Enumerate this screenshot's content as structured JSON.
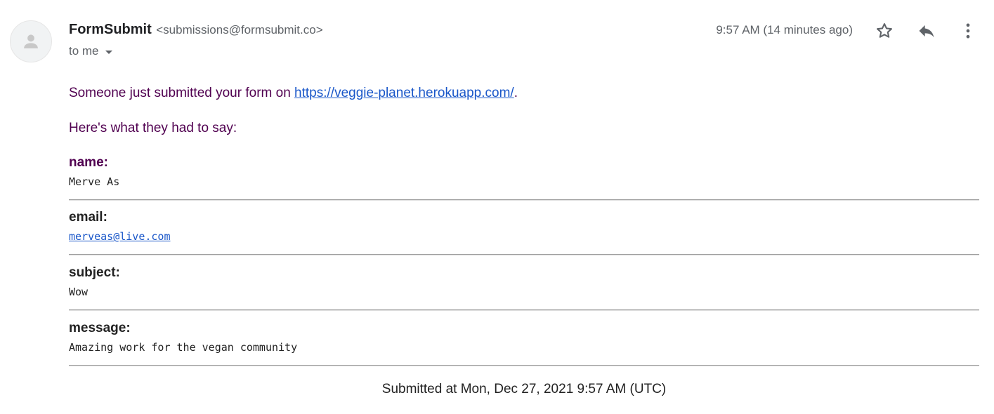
{
  "sender": {
    "name": "FormSubmit",
    "email": "<submissions@formsubmit.co>",
    "avatar_icon": "person-icon"
  },
  "recipient": {
    "label": "to me",
    "expand_icon": "caret-down-icon"
  },
  "header": {
    "timestamp": "9:57 AM (14 minutes ago)",
    "actions": [
      {
        "name": "star",
        "icon": "star-outline-icon"
      },
      {
        "name": "reply",
        "icon": "reply-icon"
      },
      {
        "name": "more",
        "icon": "more-vertical-icon"
      }
    ]
  },
  "message": {
    "intro_prefix": "Someone just submitted your form on ",
    "intro_link": "https://veggie-planet.herokuapp.com/",
    "intro_suffix": ".",
    "lead": "Here's what they had to say:",
    "fields": [
      {
        "label": "name:",
        "value": "Merve As"
      },
      {
        "label": "email:",
        "value": "merveas@live.com"
      },
      {
        "label": "subject:",
        "value": "Wow"
      },
      {
        "label": "message:",
        "value": "Amazing work for the vegan community"
      }
    ],
    "footer": "Submitted at Mon, Dec 27, 2021 9:57 AM (UTC)"
  },
  "colors": {
    "quoted_text": "#500050",
    "link": "#1a57c9",
    "muted": "#5f6368"
  }
}
